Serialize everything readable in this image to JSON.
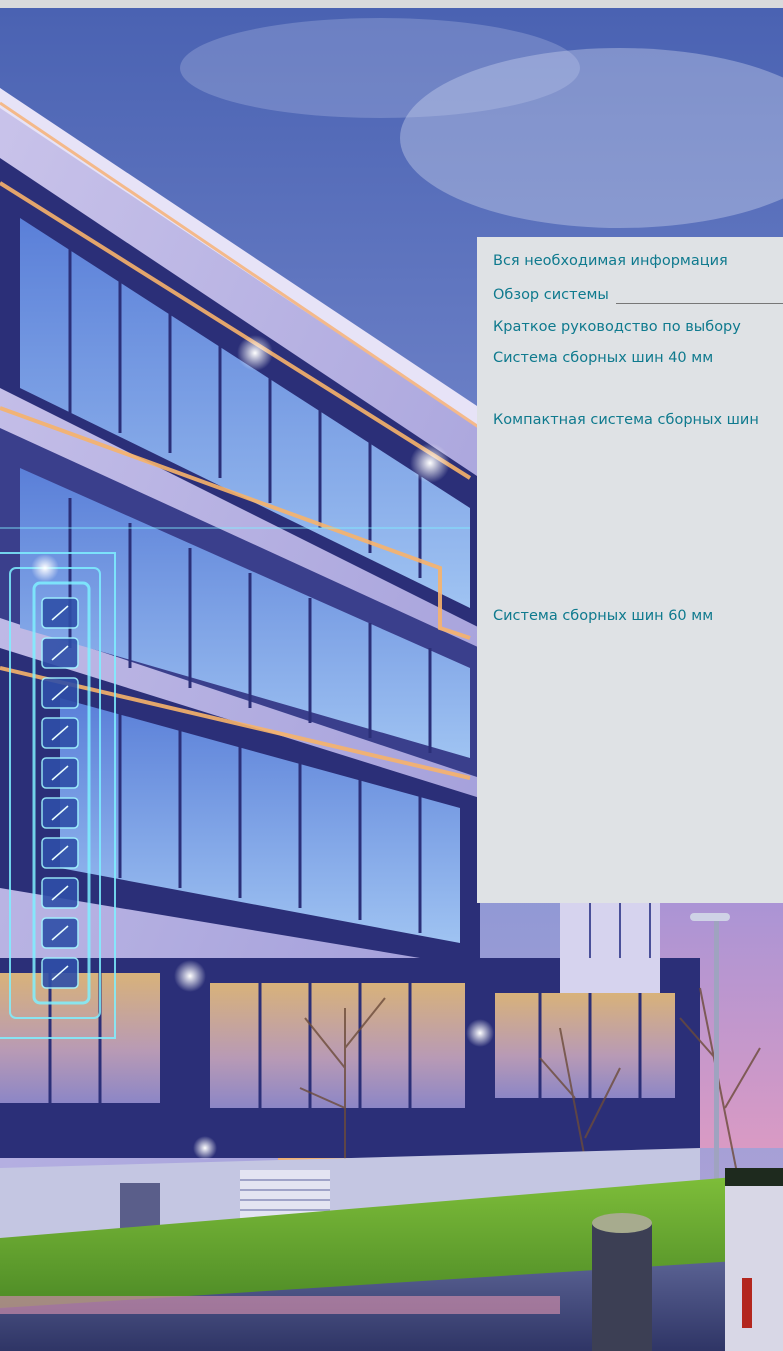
{
  "toc": {
    "items": [
      "Вся необходимая информация",
      "Обзор системы",
      "Краткое руководство по выбору",
      "Система сборных шин 40 мм",
      "Компактная система сборных шин",
      "Система сборных шин 60 мм"
    ]
  },
  "colors": {
    "panel_bg": "#dfe2e5",
    "link_text": "#0f7a8e",
    "sky_top": "#4f66b0",
    "facade_dark": "#2b2f78",
    "glow": "#7ff0ff"
  }
}
